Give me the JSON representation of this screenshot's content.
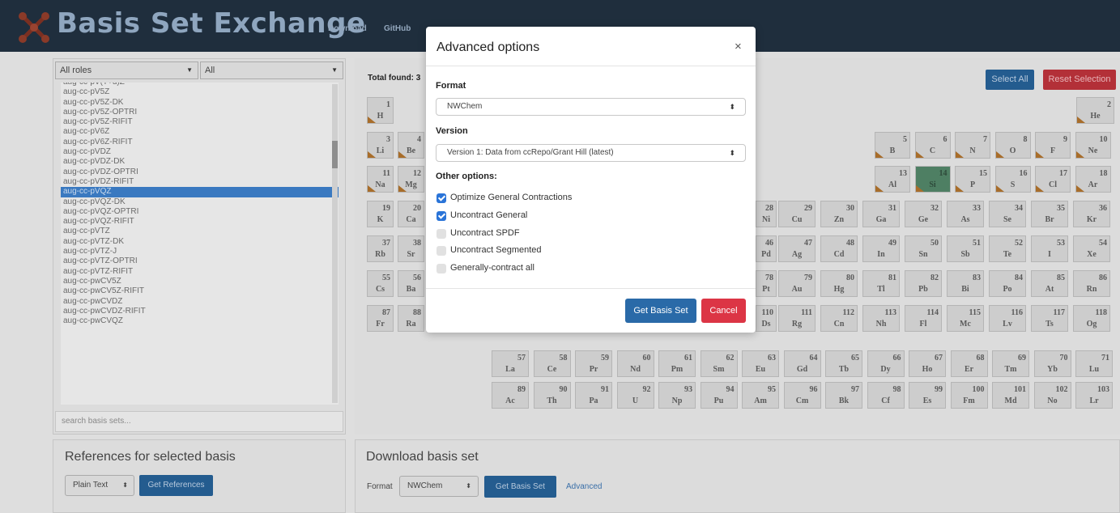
{
  "header": {
    "title": "Basis Set Exchange",
    "nav": [
      "Download",
      "GitHub"
    ]
  },
  "left": {
    "role_filter": "All roles",
    "type_filter": "All",
    "selected_basis": "aug-cc-pVQZ",
    "basis_list": [
      "aug-cc-pV(T+d)Z",
      "aug-cc-pV5Z",
      "aug-cc-pV5Z-DK",
      "aug-cc-pV5Z-OPTRI",
      "aug-cc-pV5Z-RIFIT",
      "aug-cc-pV6Z",
      "aug-cc-pV6Z-RIFIT",
      "aug-cc-pVDZ",
      "aug-cc-pVDZ-DK",
      "aug-cc-pVDZ-OPTRI",
      "aug-cc-pVDZ-RIFIT",
      "aug-cc-pVQZ",
      "aug-cc-pVQZ-DK",
      "aug-cc-pVQZ-OPTRI",
      "aug-cc-pVQZ-RIFIT",
      "aug-cc-pVTZ",
      "aug-cc-pVTZ-DK",
      "aug-cc-pVTZ-J",
      "aug-cc-pVTZ-OPTRI",
      "aug-cc-pVTZ-RIFIT",
      "aug-cc-pwCV5Z",
      "aug-cc-pwCV5Z-RIFIT",
      "aug-cc-pwCVDZ",
      "aug-cc-pwCVDZ-RIFIT",
      "aug-cc-pwCVQZ"
    ],
    "search_placeholder": "search basis sets..."
  },
  "table": {
    "total_found": "Total found: 3",
    "select_all": "Select All",
    "reset_selection": "Reset Selection",
    "selected_element": "Si",
    "elements": [
      [
        "1",
        "H"
      ],
      [
        "2",
        "He"
      ],
      [
        "3",
        "Li"
      ],
      [
        "4",
        "Be"
      ],
      [
        "5",
        "B"
      ],
      [
        "6",
        "C"
      ],
      [
        "7",
        "N"
      ],
      [
        "8",
        "O"
      ],
      [
        "9",
        "F"
      ],
      [
        "10",
        "Ne"
      ],
      [
        "11",
        "Na"
      ],
      [
        "12",
        "Mg"
      ],
      [
        "13",
        "Al"
      ],
      [
        "14",
        "Si"
      ],
      [
        "15",
        "P"
      ],
      [
        "16",
        "S"
      ],
      [
        "17",
        "Cl"
      ],
      [
        "18",
        "Ar"
      ],
      [
        "19",
        "K"
      ],
      [
        "20",
        "Ca"
      ],
      [
        "28",
        "Ni"
      ],
      [
        "29",
        "Cu"
      ],
      [
        "30",
        "Zn"
      ],
      [
        "31",
        "Ga"
      ],
      [
        "32",
        "Ge"
      ],
      [
        "33",
        "As"
      ],
      [
        "34",
        "Se"
      ],
      [
        "35",
        "Br"
      ],
      [
        "36",
        "Kr"
      ],
      [
        "37",
        "Rb"
      ],
      [
        "38",
        "Sr"
      ],
      [
        "46",
        "Pd"
      ],
      [
        "47",
        "Ag"
      ],
      [
        "48",
        "Cd"
      ],
      [
        "49",
        "In"
      ],
      [
        "50",
        "Sn"
      ],
      [
        "51",
        "Sb"
      ],
      [
        "52",
        "Te"
      ],
      [
        "53",
        "I"
      ],
      [
        "54",
        "Xe"
      ],
      [
        "55",
        "Cs"
      ],
      [
        "56",
        "Ba"
      ],
      [
        "78",
        "Pt"
      ],
      [
        "79",
        "Au"
      ],
      [
        "80",
        "Hg"
      ],
      [
        "81",
        "Tl"
      ],
      [
        "82",
        "Pb"
      ],
      [
        "83",
        "Bi"
      ],
      [
        "84",
        "Po"
      ],
      [
        "85",
        "At"
      ],
      [
        "86",
        "Rn"
      ],
      [
        "87",
        "Fr"
      ],
      [
        "88",
        "Ra"
      ],
      [
        "110",
        "Ds"
      ],
      [
        "111",
        "Rg"
      ],
      [
        "112",
        "Cn"
      ],
      [
        "113",
        "Nh"
      ],
      [
        "114",
        "Fl"
      ],
      [
        "115",
        "Mc"
      ],
      [
        "116",
        "Lv"
      ],
      [
        "117",
        "Ts"
      ],
      [
        "118",
        "Og"
      ],
      [
        "57",
        "La"
      ],
      [
        "58",
        "Ce"
      ],
      [
        "59",
        "Pr"
      ],
      [
        "60",
        "Nd"
      ],
      [
        "61",
        "Pm"
      ],
      [
        "62",
        "Sm"
      ],
      [
        "63",
        "Eu"
      ],
      [
        "64",
        "Gd"
      ],
      [
        "65",
        "Tb"
      ],
      [
        "66",
        "Dy"
      ],
      [
        "67",
        "Ho"
      ],
      [
        "68",
        "Er"
      ],
      [
        "69",
        "Tm"
      ],
      [
        "70",
        "Yb"
      ],
      [
        "71",
        "Lu"
      ],
      [
        "89",
        "Ac"
      ],
      [
        "90",
        "Th"
      ],
      [
        "91",
        "Pa"
      ],
      [
        "92",
        "U"
      ],
      [
        "93",
        "Np"
      ],
      [
        "94",
        "Pu"
      ],
      [
        "95",
        "Am"
      ],
      [
        "96",
        "Cm"
      ],
      [
        "97",
        "Bk"
      ],
      [
        "98",
        "Cf"
      ],
      [
        "99",
        "Es"
      ],
      [
        "100",
        "Fm"
      ],
      [
        "101",
        "Md"
      ],
      [
        "102",
        "No"
      ],
      [
        "103",
        "Lr"
      ]
    ],
    "available": [
      "H",
      "He",
      "Li",
      "Be",
      "Na",
      "Mg",
      "B",
      "C",
      "N",
      "O",
      "F",
      "Ne",
      "Al",
      "Si",
      "P",
      "S",
      "Cl",
      "Ar"
    ]
  },
  "references": {
    "title": "References for selected basis",
    "format": "Plain Text",
    "button": "Get References"
  },
  "download": {
    "title": "Download basis set",
    "format_label": "Format",
    "format": "NWChem",
    "button": "Get Basis Set",
    "advanced": "Advanced"
  },
  "modal": {
    "title": "Advanced options",
    "close": "×",
    "format_label": "Format",
    "format_value": "NWChem",
    "version_label": "Version",
    "version_value": "Version 1: Data from ccRepo/Grant Hill (latest)",
    "other_label": "Other options:",
    "options": [
      {
        "label": "Optimize General Contractions",
        "checked": true
      },
      {
        "label": "Uncontract General",
        "checked": true
      },
      {
        "label": "Uncontract SPDF",
        "checked": false
      },
      {
        "label": "Uncontract Segmented",
        "checked": false
      },
      {
        "label": "Generally-contract all",
        "checked": false
      }
    ],
    "get_button": "Get Basis Set",
    "cancel_button": "Cancel"
  },
  "colors": {
    "header_bg": "#1f2e3d",
    "selected_element": "#4e7f63",
    "primary_button": "#2a6aa8",
    "danger_button": "#dc3545"
  }
}
